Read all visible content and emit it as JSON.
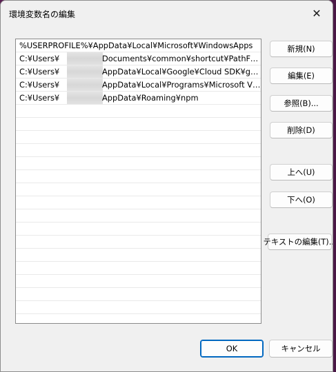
{
  "window": {
    "title": "環境変数名の編集",
    "close_glyph": "✕"
  },
  "paths": [
    {
      "prefix": "%USERPROFILE%¥AppData¥Local¥Microsoft¥WindowsApps",
      "suffix": ""
    },
    {
      "prefix": "C:¥Users¥",
      "suffix": "Documents¥common¥shortcut¥PathFolder"
    },
    {
      "prefix": "C:¥Users¥",
      "suffix": "AppData¥Local¥Google¥Cloud SDK¥goo..."
    },
    {
      "prefix": "C:¥Users¥",
      "suffix": "AppData¥Local¥Programs¥Microsoft VS ..."
    },
    {
      "prefix": "C:¥Users¥",
      "suffix": "AppData¥Roaming¥npm"
    }
  ],
  "buttons": {
    "new": "新規(N)",
    "edit": "編集(E)",
    "browse": "参照(B)...",
    "delete": "削除(D)",
    "move_up": "上へ(U)",
    "move_down": "下へ(O)",
    "edit_text": "テキストの編集(T)...",
    "ok": "OK",
    "cancel": "キャンセル"
  },
  "colors": {
    "ok_border": "#0067c0",
    "dialog_bg": "#f0f0f0"
  }
}
